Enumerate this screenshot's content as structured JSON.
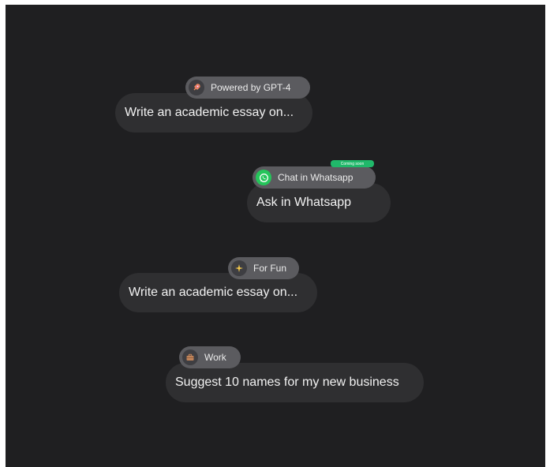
{
  "prompts": [
    {
      "tag": "Powered by GPT-4",
      "text": "Write an academic essay on...",
      "icon": "rocket-icon"
    },
    {
      "tag": "Chat in Whatsapp",
      "badge": "Coming soon",
      "text": "Ask in Whatsapp",
      "icon": "whatsapp-icon"
    },
    {
      "tag": "For Fun",
      "text": "Write an academic essay on...",
      "icon": "sparkle-icon"
    },
    {
      "tag": "Work",
      "text": "Suggest 10 names for my new business",
      "icon": "briefcase-icon"
    }
  ],
  "colors": {
    "background": "#1f1f21",
    "card": "#2f2f31",
    "tag": "#5b5b5f",
    "whatsapp": "#25c55a",
    "badge": "#20b86a"
  }
}
